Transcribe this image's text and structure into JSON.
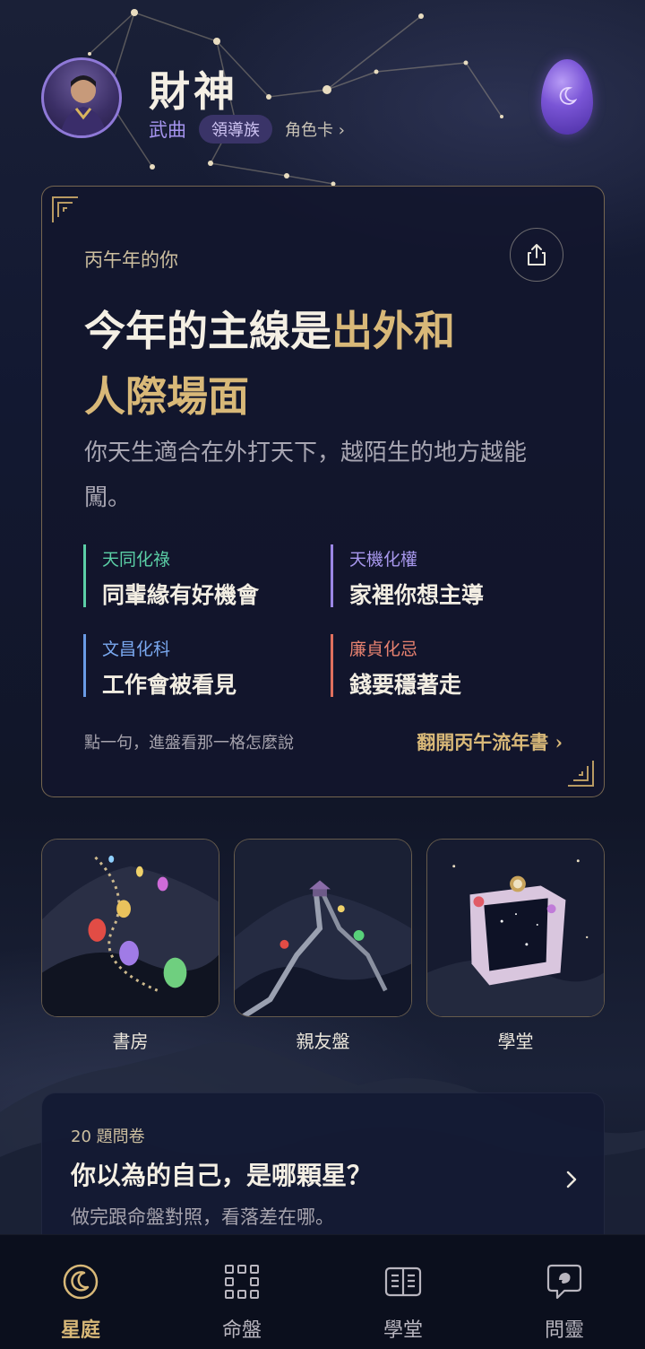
{
  "header": {
    "title": "財神",
    "star_name": "武曲",
    "tribe_badge": "領導族",
    "role_card_link": "角色卡 ›"
  },
  "main_card": {
    "year_label": "丙午年的你",
    "headline_white": "今年的主線是",
    "headline_gold_line1": "出外和",
    "headline_gold_line2": "人際場面",
    "description": "你天生適合在外打天下，越陌生的地方越能闖。",
    "traits": [
      {
        "key": "天同化祿",
        "text": "同輩緣有好機會",
        "color": "#5bcfa6"
      },
      {
        "key": "天機化權",
        "text": "家裡你想主導",
        "color": "#9b87e6"
      },
      {
        "key": "文昌化科",
        "text": "工作會被看見",
        "color": "#6a9be6"
      },
      {
        "key": "廉貞化忌",
        "text": "錢要穩著走",
        "color": "#e0705e"
      }
    ],
    "hint": "點一句，進盤看那一格怎麼說",
    "open_book_link": "翻開丙午流年書 ›"
  },
  "tiles": [
    {
      "label": "書房",
      "icon": "lantern-path-illustration"
    },
    {
      "label": "親友盤",
      "icon": "mountain-stairs-illustration"
    },
    {
      "label": "學堂",
      "icon": "star-cube-illustration"
    }
  ],
  "quiz": {
    "count": "20 題問卷",
    "title": "你以為的自己，是哪顆星？",
    "subtitle": "做完跟命盤對照，看落差在哪。"
  },
  "bottom_nav": [
    {
      "label": "星庭",
      "icon": "moon-icon",
      "active": true
    },
    {
      "label": "命盤",
      "icon": "grid-chart-icon",
      "active": false
    },
    {
      "label": "學堂",
      "icon": "open-book-icon",
      "active": false
    },
    {
      "label": "問靈",
      "icon": "chat-bubble-icon",
      "active": false
    }
  ],
  "colors": {
    "accent_gold": "#d8b878",
    "accent_purple": "#a594ee",
    "background": "#121831"
  }
}
